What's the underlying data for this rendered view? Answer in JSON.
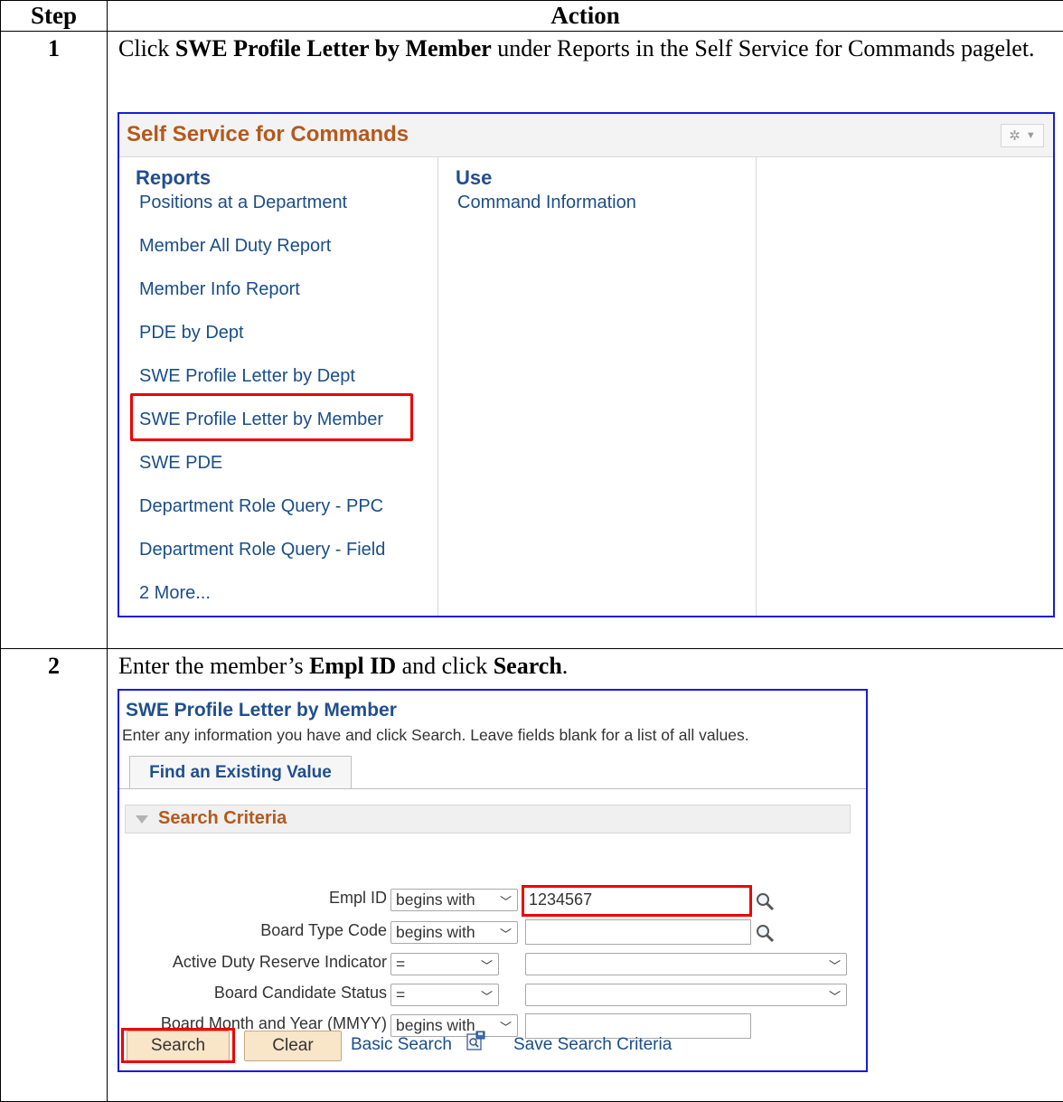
{
  "table": {
    "header_step": "Step",
    "header_action": "Action"
  },
  "steps": [
    {
      "number": "1",
      "text_pre": "Click ",
      "text_bold": "SWE Profile Letter by Member",
      "text_post": " under Reports in the Self Service for Commands pagelet."
    },
    {
      "number": "2",
      "text_pre": "Enter the member’s ",
      "text_bold1": "Empl ID",
      "text_mid": " and click ",
      "text_bold2": "Search",
      "text_post": "."
    }
  ],
  "pagelet": {
    "title": "Self Service for Commands",
    "reports_heading": "Reports",
    "use_heading": "Use",
    "reports": [
      "Positions at a Department",
      "Member All Duty Report",
      "Member Info Report",
      "PDE by Dept",
      "SWE Profile Letter by Dept",
      "SWE Profile Letter by Member",
      "SWE PDE",
      "Department Role Query - PPC",
      "Department Role Query - Field",
      "2 More..."
    ],
    "use": [
      "Command Information"
    ]
  },
  "search_page": {
    "title": "SWE Profile Letter by Member",
    "description": "Enter any information you have and click Search. Leave fields blank for a list of all values.",
    "tab": "Find an Existing Value",
    "criteria_label": "Search Criteria",
    "fields": [
      {
        "label": "Empl ID",
        "operator": "begins with",
        "value": "1234567"
      },
      {
        "label": "Board Type Code",
        "operator": "begins with",
        "value": ""
      },
      {
        "label": "Active Duty Reserve Indicator",
        "operator": "=",
        "value": ""
      },
      {
        "label": "Board Candidate Status",
        "operator": "=",
        "value": ""
      },
      {
        "label": "Board Month and Year (MMYY)",
        "operator": "begins with",
        "value": ""
      }
    ],
    "search_button": "Search",
    "clear_button": "Clear",
    "basic_search": "Basic Search",
    "save_criteria": "Save Search Criteria"
  },
  "colors": {
    "screenshot_border": "#1a1adb",
    "highlight": "#ee0000",
    "pagelet_title": "#b5591b",
    "link": "#1a4e8a"
  }
}
